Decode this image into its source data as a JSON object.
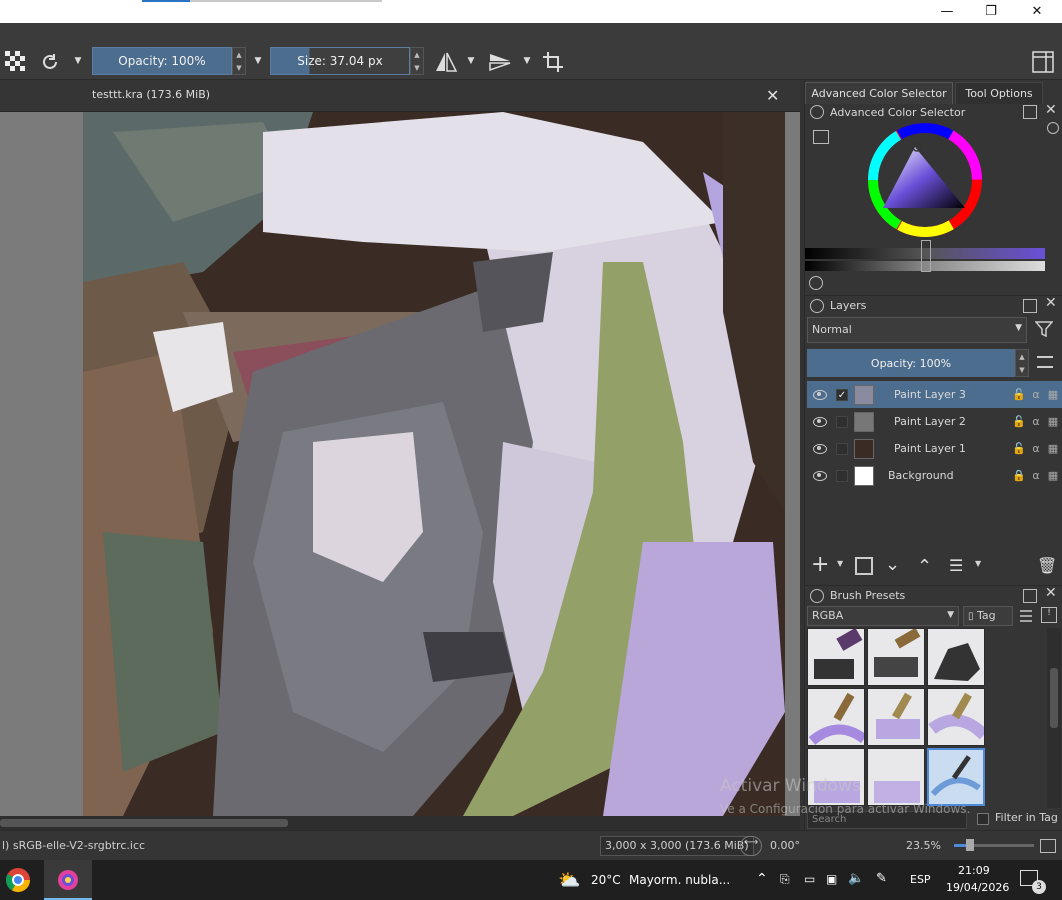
{
  "window": {
    "minimize": "—",
    "restore": "❐",
    "close": "✕"
  },
  "toolbar": {
    "opacity_label": "Opacity: 100%",
    "size_label": "Size: 37.04 px"
  },
  "document": {
    "tab_title": "testtt.kra (173.6 MiB)",
    "close": "✕"
  },
  "docker": {
    "tabs": [
      "Advanced Color Selector",
      "Tool Options"
    ],
    "color_selector_title": "Advanced Color Selector",
    "layers": {
      "title": "Layers",
      "blend_mode": "Normal",
      "opacity_label": "Opacity:  100%",
      "items": [
        {
          "name": "Paint Layer 3",
          "selected": true,
          "checked": "✓"
        },
        {
          "name": "Paint Layer 2",
          "selected": false,
          "checked": ""
        },
        {
          "name": "Paint Layer 1",
          "selected": false,
          "checked": ""
        },
        {
          "name": "Background",
          "selected": false,
          "checked": ""
        }
      ]
    },
    "brush_presets": {
      "title": "Brush Presets",
      "resource_filter": "RGBA",
      "tag_label": "Tag",
      "search_placeholder": "Search",
      "filter_in_tag": "Filter in Tag"
    }
  },
  "status": {
    "color_profile": "l)  sRGB-elle-V2-srgbtrc.icc",
    "image_size": "3,000 x 3,000 (173.6 MiB)",
    "rotation": "0.00°",
    "zoom": "23.5%"
  },
  "watermark": {
    "line1": "Activar Windows",
    "line2": "Ve a Configuración para activar Windows."
  },
  "taskbar": {
    "weather_temp": "20°C",
    "weather_text": "Mayorm. nubla...",
    "language": "ESP",
    "time": "21:09",
    "date": "19/04/2026",
    "notification_count": "3"
  },
  "colors": {
    "accent": "#4d6d8e",
    "panel": "#353535",
    "toolbar": "#3b3b3b",
    "canvas_bg": "#7a7a7a",
    "taskbar": "#1f1f1f"
  }
}
